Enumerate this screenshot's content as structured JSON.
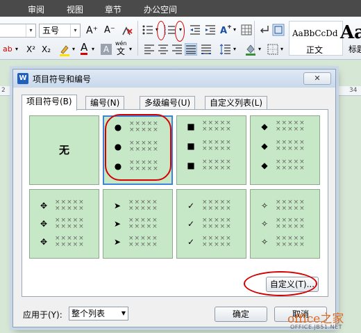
{
  "menu": [
    "审阅",
    "视图",
    "章节",
    "办公空间"
  ],
  "ribbon": {
    "font_size": "五号",
    "font_size_dropdown": "▾",
    "grow_font": "A⁺",
    "shrink_font": "A⁻",
    "superscript": "X²",
    "subscript": "X₂",
    "font_color": "A",
    "char_shading": "A",
    "phonetic_top": "wén",
    "phonetic_bottom": "文",
    "style_normal_preview": "AaBbCcDd",
    "style_normal_label": "正文",
    "style_heading_preview": "Aa",
    "style_heading_label": "标题",
    "left_label": "ab"
  },
  "ruler": {
    "left_number": "2",
    "right_number": "34"
  },
  "dialog": {
    "title": "项目符号和编号",
    "app_icon_letter": "W",
    "close": "✕",
    "tabs": [
      {
        "label": "项目符号(B)",
        "active": true
      },
      {
        "label": "编号(N)",
        "active": false
      },
      {
        "label": "多级编号(U)",
        "active": false
      },
      {
        "label": "自定义列表(L)",
        "active": false
      }
    ],
    "bullets": [
      {
        "id": "none",
        "label": "无",
        "symbol": ""
      },
      {
        "id": "round-dot",
        "symbol": "●",
        "selected": true
      },
      {
        "id": "square",
        "symbol": "■"
      },
      {
        "id": "diamond",
        "symbol": "◆"
      },
      {
        "id": "four-diamond",
        "symbol": "✥"
      },
      {
        "id": "arrowhead",
        "symbol": "➤"
      },
      {
        "id": "check",
        "symbol": "✓"
      },
      {
        "id": "star",
        "symbol": "✧"
      }
    ],
    "placeholder_text": "×××××",
    "custom_button": "自定义(T)...",
    "apply_to_label": "应用于(Y):",
    "apply_to_value": "整个列表",
    "ok_button": "确定",
    "cancel_button": "取消"
  },
  "watermark": {
    "main": "office之家",
    "sub": "OFFICE.JB51.NET"
  },
  "colors": {
    "annotation_red": "#d40000",
    "bullet_cell_bg": "#c6e8c6",
    "selection_blue": "#3c82d6"
  }
}
